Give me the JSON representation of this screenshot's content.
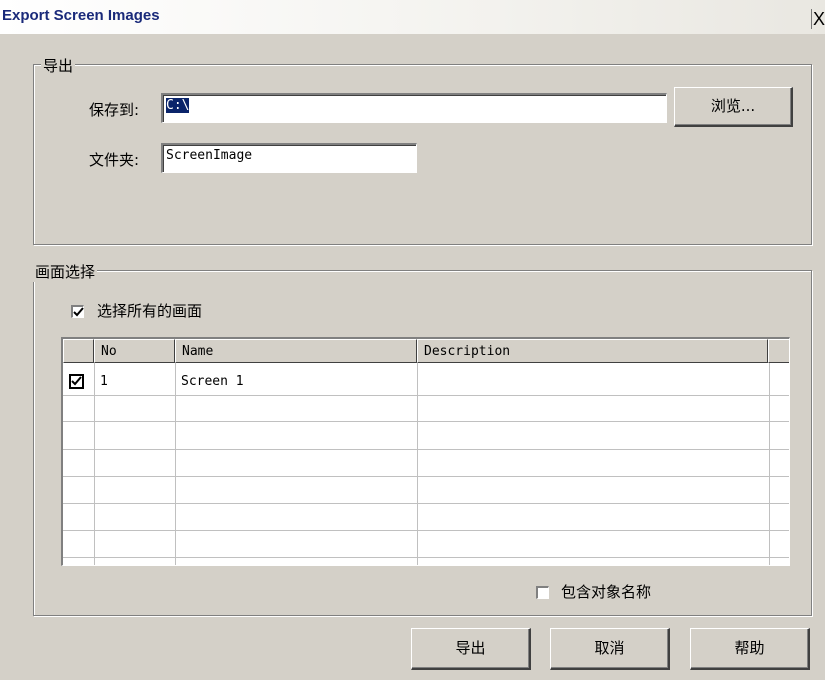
{
  "dialog": {
    "title": "Export Screen Images",
    "close_label": "X"
  },
  "export_group": {
    "legend": "导出",
    "save_to_label": "保存到:",
    "save_to_value": "C:\\",
    "browse_button": "浏览...",
    "folder_label": "文件夹:",
    "folder_value": "ScreenImage"
  },
  "screen_group": {
    "legend": "画面选择",
    "select_all_label": "选择所有的画面",
    "select_all_checked": true,
    "columns": [
      "No",
      "Name",
      "Description"
    ],
    "rows": [
      {
        "checked": true,
        "no": "1",
        "name": "Screen 1",
        "description": ""
      }
    ],
    "include_names_label": "包含对象名称",
    "include_names_checked": false
  },
  "buttons": {
    "export": "导出",
    "cancel": "取消",
    "help": "帮助"
  }
}
